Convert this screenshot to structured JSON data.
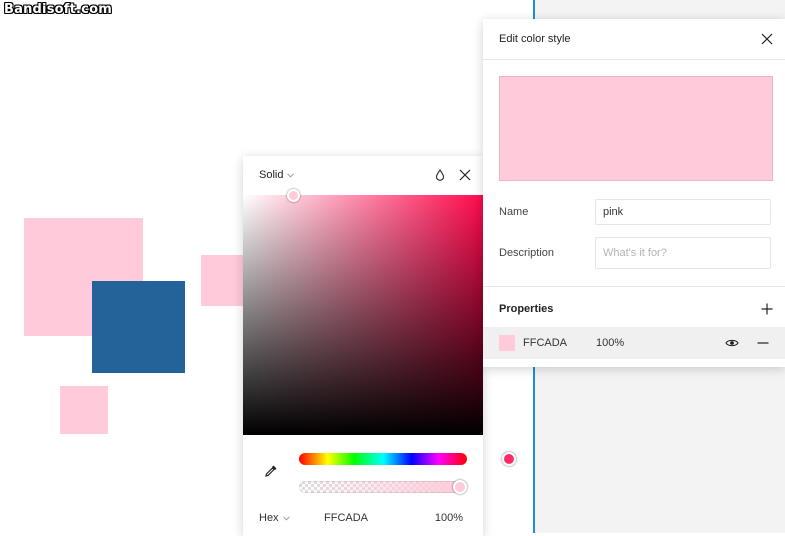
{
  "watermark": "Bandisoft.com",
  "colors": {
    "pink": "#FFCADA",
    "blue": "#236399",
    "guide": "#1D8FE0",
    "canvas": "#FFFFFF",
    "sidebar": "#F3F3F3"
  },
  "picker": {
    "mode_label": "Solid",
    "icons": [
      "chevron-down-icon",
      "opacity-drop-icon",
      "close-icon",
      "eyedropper-icon"
    ],
    "format_label": "Hex",
    "hex_value": "FFCADA",
    "opacity_value": "100%",
    "hue_position_fraction": 0.95,
    "alpha_value_fraction": 1.0
  },
  "panel": {
    "title": "Edit color style",
    "name_label": "Name",
    "name_value": "pink",
    "description_label": "Description",
    "description_placeholder": "What's it for?",
    "properties_label": "Properties",
    "property": {
      "hex": "FFCADA",
      "opacity": "100%"
    },
    "icons": [
      "close-icon",
      "plus-icon",
      "eye-icon",
      "minus-icon"
    ]
  }
}
